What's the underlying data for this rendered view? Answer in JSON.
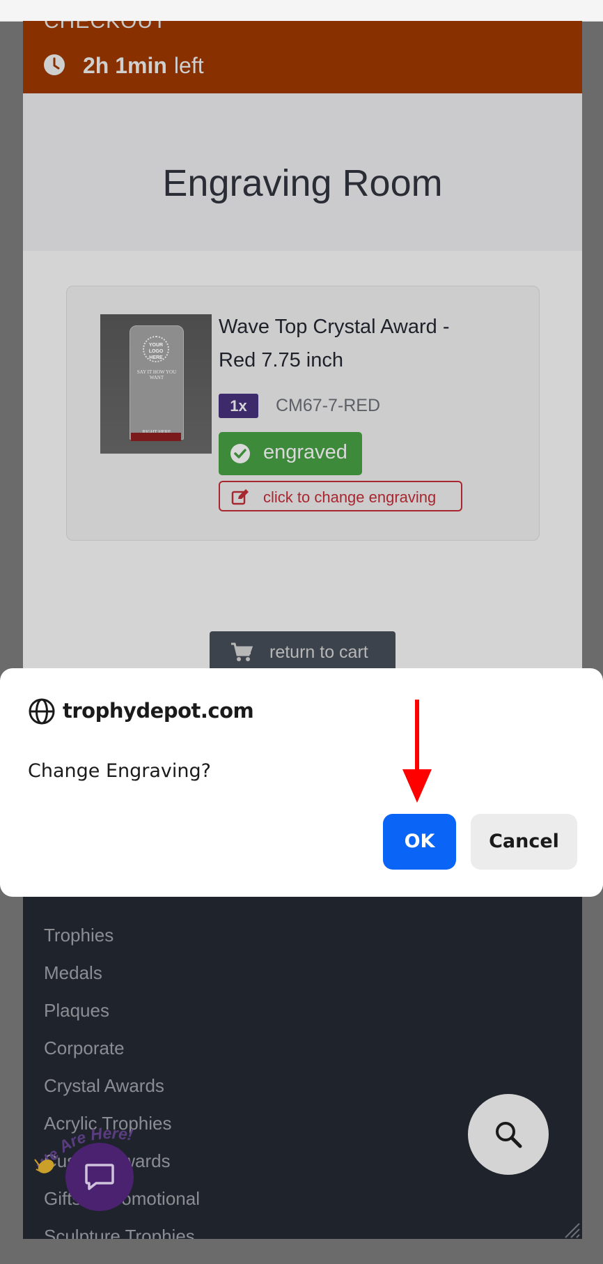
{
  "checkout": {
    "title": "CHECKOUT",
    "time": "2h 1min",
    "suffix": "left"
  },
  "page": {
    "title": "Engraving Room"
  },
  "product": {
    "name_line1": "Wave Top Crystal Award -",
    "name_line2": "Red 7.75 inch",
    "quantity": "1x",
    "sku": "CM67-7-RED",
    "status_label": "engraved",
    "change_label": "click to change engraving",
    "image_text": {
      "logo": "YOUR LOGO HERE",
      "headline": "SAY IT HOW YOU WANT",
      "footer": "RIGHT HERE"
    }
  },
  "cart": {
    "return_label": "return to cart"
  },
  "dialog": {
    "domain": "trophydepot.com",
    "message": "Change Engraving?",
    "ok_label": "OK",
    "cancel_label": "Cancel"
  },
  "footer": {
    "links": [
      "Trophies",
      "Medals",
      "Plaques",
      "Corporate",
      "Crystal Awards",
      "Acrylic Trophies",
      "Custom Awards",
      "Gifts & Promotional",
      "Sculpture Trophies"
    ]
  },
  "chat": {
    "tag": "We Are Here!"
  },
  "colors": {
    "checkout_bar": "#883000",
    "ok_button": "#0a64f6",
    "engraved_badge": "#3d8a3a",
    "change_border": "#a8262f",
    "quantity_badge": "#3c2a6a",
    "arrow": "#ff0000",
    "footer": "#1f232c"
  },
  "icons": [
    "clock-icon",
    "check-icon",
    "edit-icon",
    "cart-icon",
    "globe-icon",
    "search-icon",
    "chat-icon",
    "arrow-down-icon"
  ]
}
